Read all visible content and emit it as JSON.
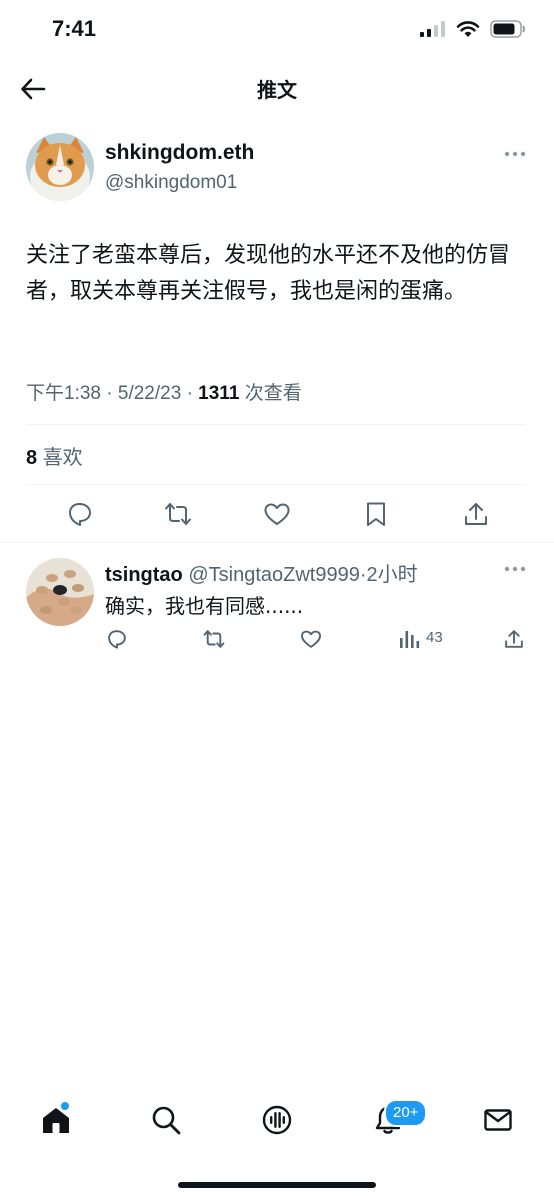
{
  "status_bar": {
    "time": "7:41"
  },
  "header": {
    "title": "推文"
  },
  "tweet": {
    "author_name": "shkingdom.eth",
    "author_handle": "@shkingdom01",
    "text": "关注了老蛮本尊后，发现他的水平还不及他的仿冒者，取关本尊再关注假号，我也是闲的蛋痛。",
    "time": "下午1:38",
    "date": "5/22/23",
    "views": "1311",
    "views_label": "次查看",
    "likes": "8",
    "likes_label": "喜欢"
  },
  "reply": {
    "author_name": "tsingtao",
    "author_handle": "@TsingtaoZwt9999",
    "age": "2小时",
    "text": "确实，我也有同感......",
    "views": "43"
  },
  "tabbar": {
    "notifications_badge": "20+"
  },
  "colors": {
    "accent": "#1d9bf0",
    "text": "#0f1419",
    "secondary": "#536471",
    "divider": "#eff3f4"
  },
  "icons": [
    "back-arrow-icon",
    "more-icon",
    "reply-icon",
    "retweet-icon",
    "like-icon",
    "bookmark-icon",
    "share-icon",
    "views-icon",
    "home-icon",
    "search-icon",
    "spaces-icon",
    "bell-icon",
    "mail-icon"
  ]
}
